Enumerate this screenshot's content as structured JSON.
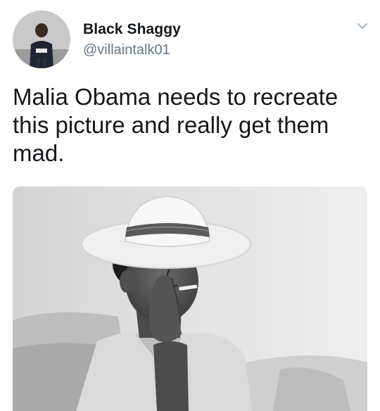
{
  "tweet": {
    "author": {
      "display_name": "Black Shaggy",
      "handle": "@villaintalk01",
      "avatar_icon": "user-avatar"
    },
    "text": "Malia Obama needs to recreate\nthis picture and really get them\nmad.",
    "menu_icon": "chevron-down-icon",
    "media": {
      "type": "photo",
      "style": "black-and-white"
    }
  },
  "colors": {
    "text_primary": "#14171a",
    "text_secondary": "#657786",
    "caret": "#aab8c2"
  }
}
